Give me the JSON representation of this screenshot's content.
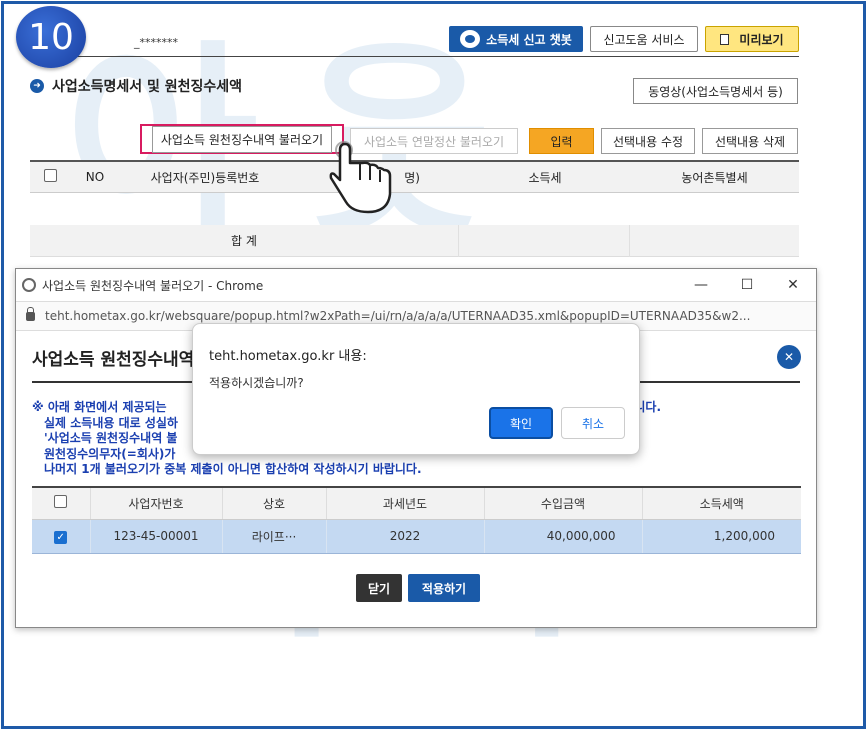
{
  "step": "10",
  "user_masked": "_*******",
  "header": {
    "chatbot_label": "소득세 신고 챗봇",
    "help_label": "신고도움 서비스",
    "preview_label": "미리보기"
  },
  "section": {
    "title": "사업소득명세서 및 원천징수세액",
    "video_label": "동영상(사업소득명세서 등)"
  },
  "actions": {
    "load_withholding": "사업소득 원천징수내역 불러오기",
    "load_year_end": "사업소득 연말정산 불러오기",
    "input": "입력",
    "edit_selected": "선택내용 수정",
    "delete_selected": "선택내용 삭제"
  },
  "grid": {
    "columns": [
      "NO",
      "사업자(주민)등록번호",
      "명)",
      "소득세",
      "농어촌특별세"
    ],
    "sum_label": "합 계"
  },
  "popup": {
    "window_title": "사업소득 원천징수내역 불러오기 - Chrome",
    "url": "teht.hometax.go.kr/websquare/popup.html?w2xPath=/ui/rn/a/a/a/a/UTERNAAD35.xml&popupID=UTERNAAD35&w2...",
    "header": "사업소득 원천징수내역",
    "notice": {
      "line1_left": "※ 아래 화면에서 제공되는",
      "line1_right": "니다.",
      "line2": "실제 소득내용 대로 성실하",
      "line3": "'사업소득 원천징수내역 불",
      "line4": "원천징수의무자(=회사)가",
      "line5": "나머지 1개 불러오기가 중복 제출이 아니면 합산하여 작성하시기 바랍니다."
    },
    "table": {
      "headers": [
        "사업자번호",
        "상호",
        "과세년도",
        "수입금액",
        "소득세액"
      ],
      "rows": [
        {
          "biz_no": "123-45-00001",
          "name": "라이프···",
          "year": "2022",
          "revenue": "40,000,000",
          "tax": "1,200,000"
        }
      ]
    },
    "close_label": "닫기",
    "apply_label": "적용하기"
  },
  "alert": {
    "title": "teht.hometax.go.kr 내용:",
    "message": "적용하시겠습니까?",
    "ok_label": "확인",
    "cancel_label": "취소"
  },
  "watermark": {
    "line1": "아웃",
    "line2": "회계"
  },
  "colors": {
    "brand_blue": "#1a5aa8",
    "highlight_pink": "#d81b60",
    "input_orange": "#f5a623",
    "preview_yellow": "#ffe680",
    "notice_blue": "#1a3fb0"
  }
}
